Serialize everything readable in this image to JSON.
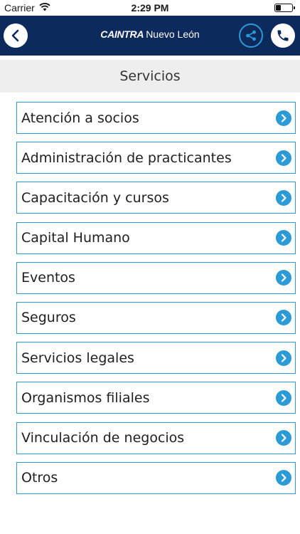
{
  "status_bar": {
    "carrier": "Carrier",
    "time": "2:29 PM",
    "battery_level": 0.35
  },
  "navbar": {
    "brand_main": "CAINTRA",
    "brand_sub": "Nuevo León",
    "back_icon": "chevron-left-icon",
    "share_icon": "share-icon",
    "phone_icon": "phone-icon",
    "colors": {
      "background": "#0d2a5c",
      "accent": "#2c9ad6"
    }
  },
  "page": {
    "title": "Servicios"
  },
  "menu": {
    "items": [
      {
        "label": "Atención a socios"
      },
      {
        "label": "Administración de practicantes"
      },
      {
        "label": "Capacitación y cursos"
      },
      {
        "label": "Capital Humano"
      },
      {
        "label": "Eventos"
      },
      {
        "label": "Seguros"
      },
      {
        "label": "Servicios legales"
      },
      {
        "label": "Organismos filiales"
      },
      {
        "label": "Vinculación de negocios"
      },
      {
        "label": "Otros"
      }
    ],
    "item_icon": "chevron-right-icon",
    "accent_color": "#2c9ad6"
  }
}
